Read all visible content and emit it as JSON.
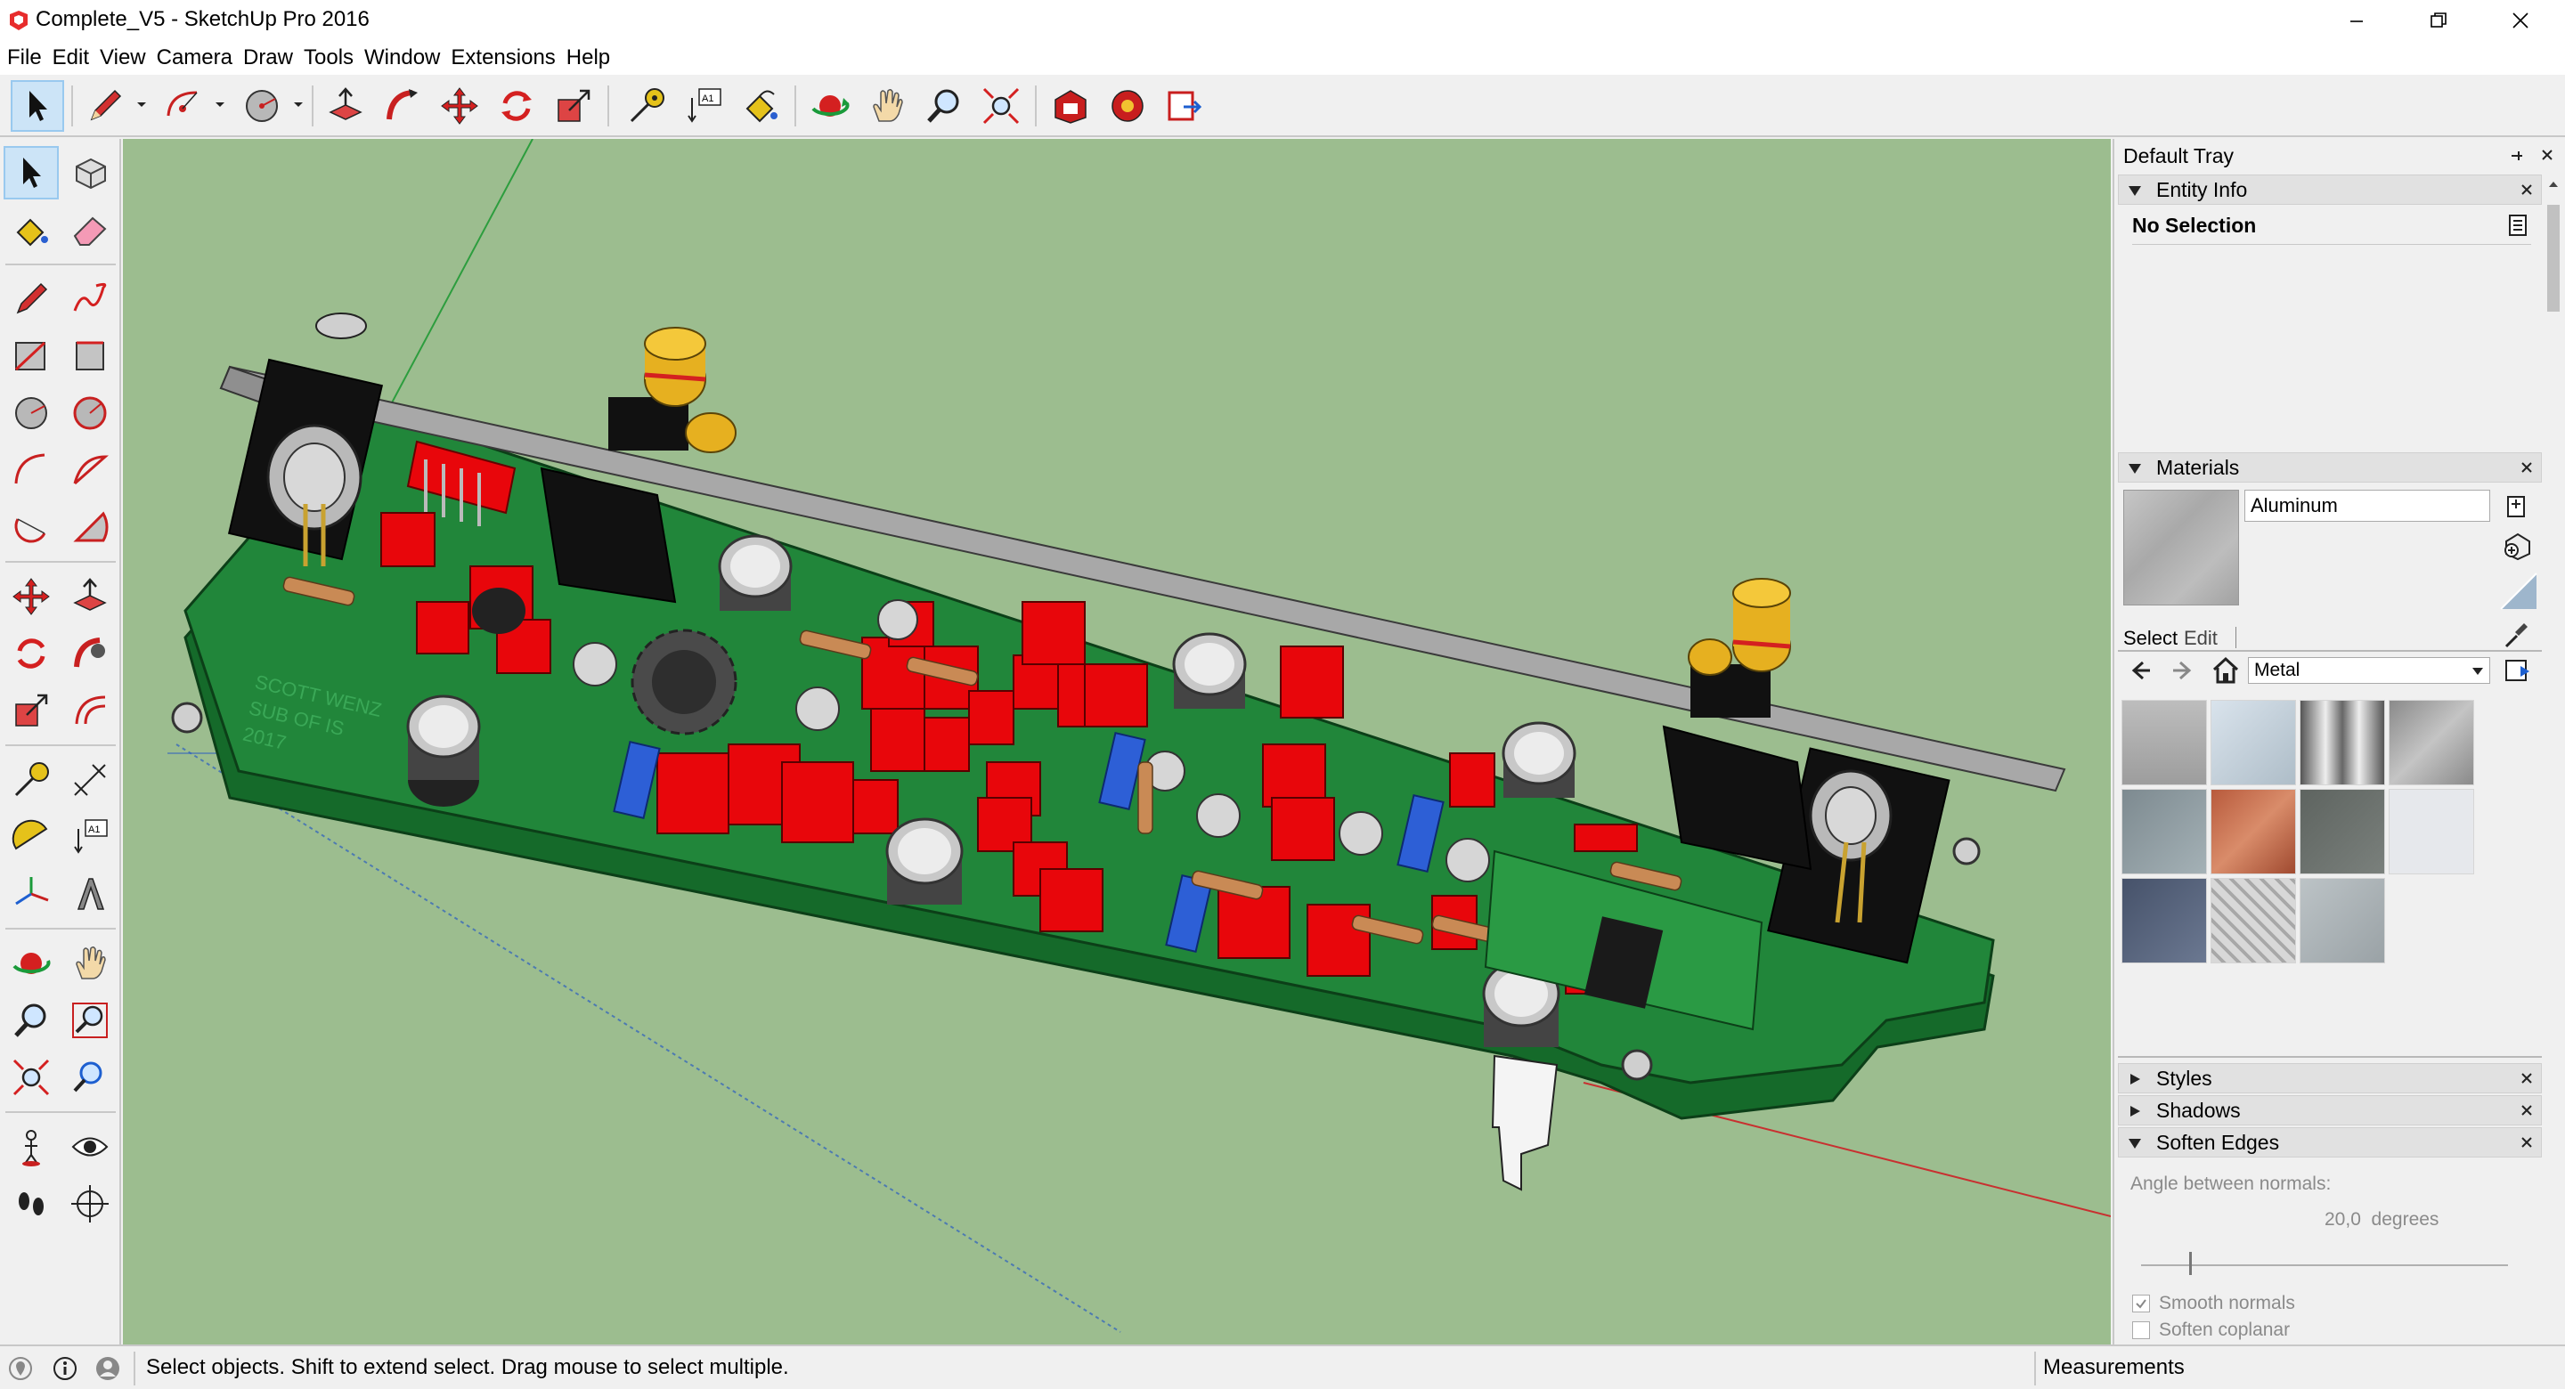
{
  "window": {
    "title": "Complete_V5 - SketchUp Pro 2016"
  },
  "menu": [
    "File",
    "Edit",
    "View",
    "Camera",
    "Draw",
    "Tools",
    "Window",
    "Extensions",
    "Help"
  ],
  "tray": {
    "title": "Default Tray",
    "entity_info": {
      "header": "Entity Info",
      "selection": "No Selection"
    },
    "materials": {
      "header": "Materials",
      "material_name": "Aluminum",
      "tab_select": "Select",
      "tab_edit": "Edit",
      "library": "Metal"
    },
    "styles": {
      "header": "Styles"
    },
    "shadows": {
      "header": "Shadows"
    },
    "soften_edges": {
      "header": "Soften Edges",
      "angle_label": "Angle between normals:",
      "angle_value": "20,0  degrees",
      "smooth_normals": "Smooth normals",
      "soften_coplanar": "Soften coplanar",
      "smooth_checked": true,
      "coplanar_checked": false
    }
  },
  "status": {
    "hint": "Select objects. Shift to extend select. Drag mouse to select multiple.",
    "measurements_label": "Measurements"
  },
  "colors": {
    "viewport_bg": "#9cbd8f",
    "pcb_green": "#1f7a34",
    "component_red": "#e8060b",
    "aluminum_panel": "#a8a8a8",
    "trimmer_blue": "#2d5fd6",
    "rca_gold": "#e6b020",
    "selection_blue": "#cce4f7"
  },
  "pcb_silkscreen": {
    "line1": "SCOTT WENZ",
    "line2": "SUB OF IS",
    "line3": "2017"
  }
}
